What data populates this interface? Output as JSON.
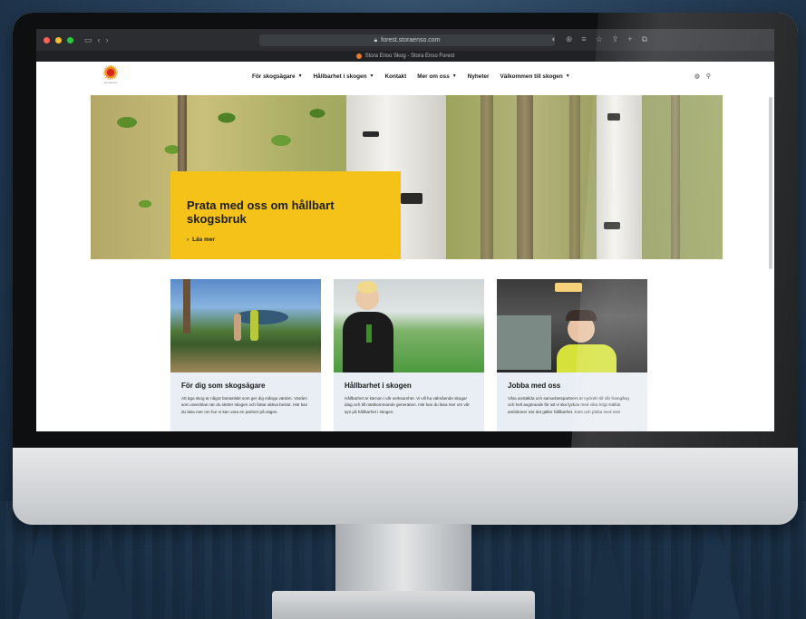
{
  "browser": {
    "url": "forest.storaenso.com",
    "tab_title": "Stora Enso Skog - Stora Enso Forest"
  },
  "site": {
    "logo_text": "storaenso",
    "nav": [
      {
        "label": "För skogsägare",
        "dropdown": true
      },
      {
        "label": "Hållbarhet i skogen",
        "dropdown": true
      },
      {
        "label": "Kontakt",
        "dropdown": false
      },
      {
        "label": "Mer om oss",
        "dropdown": true
      },
      {
        "label": "Nyheter",
        "dropdown": false
      },
      {
        "label": "Välkommen till skogen",
        "dropdown": true
      }
    ]
  },
  "hero": {
    "title": "Prata med oss om hållbart skogsbruk",
    "link": "Läs mer"
  },
  "cards": [
    {
      "title": "För dig som skogsägare",
      "text": "Att äga skog är något fantastiskt som ger dig många värden. Värden som utvecklas när du sköter skogen och fattar aktiva beslut. Här kan du läsa mer om hur vi kan vara en partner på vägen."
    },
    {
      "title": "Hållbarhet i skogen",
      "text": "Hållbarhet är kärnan i vår verksamhet. Vi vill ha välmående skogar idag och till nästkommande generation. Här kan du läsa mer om vår syn på hållbarhet i skogen."
    },
    {
      "title": "Jobba med oss",
      "text": "Våra anställda och samarbetspartners är nyckeln till vår framgång och helt avgörande för att vi ska lyckas med våra högt ställda ambitioner när det gäller hållbarhet. Kom och jobba med oss!"
    }
  ],
  "colors": {
    "accent_yellow": "#f5c219",
    "card_bg": "#e9eef4",
    "browser_chrome": "#2b2d31"
  }
}
